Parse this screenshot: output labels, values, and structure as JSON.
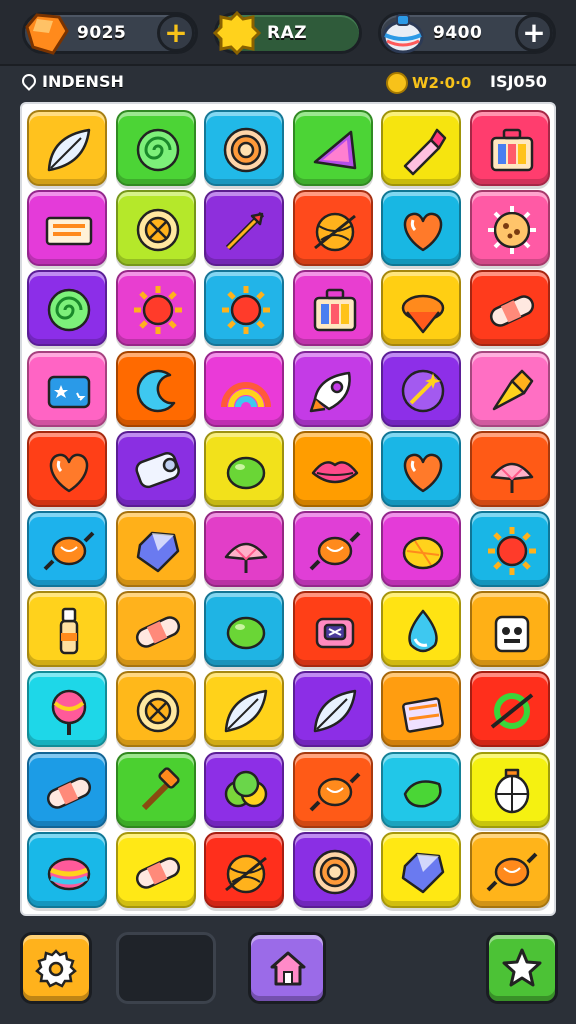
{
  "topbar": {
    "gems": {
      "value": "9025",
      "icon": "orange-gem-icon",
      "add_label": "+"
    },
    "energy": {
      "value": "RAZ",
      "icon": "yellow-star-icon"
    },
    "orbs": {
      "value": "9400",
      "icon": "striped-orb-icon",
      "add_label": "+"
    }
  },
  "inforow": {
    "player_name": "INDENSH",
    "coins_value": "W2·0·0",
    "score": "ISJ050"
  },
  "board": {
    "rows": [
      [
        {
          "color": "#ffc21e",
          "icon": "leaf"
        },
        {
          "color": "#4cd436",
          "icon": "swirl"
        },
        {
          "color": "#21b9e8",
          "icon": "target"
        },
        {
          "color": "#4cd436",
          "icon": "triangle"
        },
        {
          "color": "#f6e40f",
          "icon": "lipstick"
        },
        {
          "color": "#ff3d6e",
          "icon": "case"
        }
      ],
      [
        {
          "color": "#e43bd9",
          "icon": "box"
        },
        {
          "color": "#b5e82a",
          "icon": "cog"
        },
        {
          "color": "#8e2fdc",
          "icon": "arrow"
        },
        {
          "color": "#ff4a1c",
          "icon": "ball"
        },
        {
          "color": "#18b7e3",
          "icon": "heart"
        },
        {
          "color": "#ff5aa5",
          "icon": "cookie"
        }
      ],
      [
        {
          "color": "#8c2ee8",
          "icon": "swirl"
        },
        {
          "color": "#e83ed0",
          "icon": "sun"
        },
        {
          "color": "#22b4e8",
          "icon": "sun"
        },
        {
          "color": "#e83ed0",
          "icon": "case"
        },
        {
          "color": "#ffcf13",
          "icon": "top"
        },
        {
          "color": "#ff3b1c",
          "icon": "bandage"
        }
      ],
      [
        {
          "color": "#ff64c4",
          "icon": "card"
        },
        {
          "color": "#ff6a00",
          "icon": "moon"
        },
        {
          "color": "#ea3ad8",
          "icon": "rainbow"
        },
        {
          "color": "#c43be6",
          "icon": "rocket"
        },
        {
          "color": "#8d2fe8",
          "icon": "wand"
        },
        {
          "color": "#ff6fc3",
          "icon": "cone"
        }
      ],
      [
        {
          "color": "#ff3f17",
          "icon": "heart"
        },
        {
          "color": "#8a2fe2",
          "icon": "scroll"
        },
        {
          "color": "#f2e11b",
          "icon": "egg"
        },
        {
          "color": "#ff9d00",
          "icon": "lips"
        },
        {
          "color": "#1ab6e6",
          "icon": "heart"
        },
        {
          "color": "#ff5a16",
          "icon": "shell"
        }
      ],
      [
        {
          "color": "#1db2ec",
          "icon": "candy"
        },
        {
          "color": "#ffb019",
          "icon": "gem"
        },
        {
          "color": "#e23ec8",
          "icon": "shell"
        },
        {
          "color": "#e03fd6",
          "icon": "candy"
        },
        {
          "color": "#e43bd8",
          "icon": "lemon"
        },
        {
          "color": "#19b6e6",
          "icon": "sun"
        }
      ],
      [
        {
          "color": "#ffd21c",
          "icon": "bottle"
        },
        {
          "color": "#ffb21c",
          "icon": "bandage"
        },
        {
          "color": "#1fb4e4",
          "icon": "egg"
        },
        {
          "color": "#ff3f17",
          "icon": "watch"
        },
        {
          "color": "#ffe313",
          "icon": "drop"
        },
        {
          "color": "#ffb016",
          "icon": "robot"
        }
      ],
      [
        {
          "color": "#1ed7e8",
          "icon": "lollipop"
        },
        {
          "color": "#ffb81a",
          "icon": "cog"
        },
        {
          "color": "#ffd21a",
          "icon": "leaf"
        },
        {
          "color": "#8c2ee6",
          "icon": "leaf"
        },
        {
          "color": "#ff9d10",
          "icon": "cake"
        },
        {
          "color": "#ff2f1c",
          "icon": "ring"
        }
      ],
      [
        {
          "color": "#1c9ce6",
          "icon": "bandage"
        },
        {
          "color": "#4bd030",
          "icon": "hammer"
        },
        {
          "color": "#8d2fe6",
          "icon": "bush"
        },
        {
          "color": "#ff5a17",
          "icon": "candy"
        },
        {
          "color": "#21c7e8",
          "icon": "pickle"
        },
        {
          "color": "#f5f111",
          "icon": "lantern"
        }
      ],
      [
        {
          "color": "#19b8e8",
          "icon": "rainbowegg"
        },
        {
          "color": "#ffe816",
          "icon": "bandage"
        },
        {
          "color": "#ff2f1c",
          "icon": "ball"
        },
        {
          "color": "#8a2fe4",
          "icon": "target"
        },
        {
          "color": "#ffe813",
          "icon": "gem"
        },
        {
          "color": "#ffb41a",
          "icon": "candy"
        }
      ]
    ]
  },
  "bottom_nav": {
    "settings": {
      "icon": "gear-icon",
      "color": "#ffb21c"
    },
    "empty_slot": {},
    "home": {
      "icon": "home-icon",
      "color": "#9b6be8"
    },
    "favorites": {
      "icon": "star-icon",
      "color": "#4cc236"
    }
  }
}
